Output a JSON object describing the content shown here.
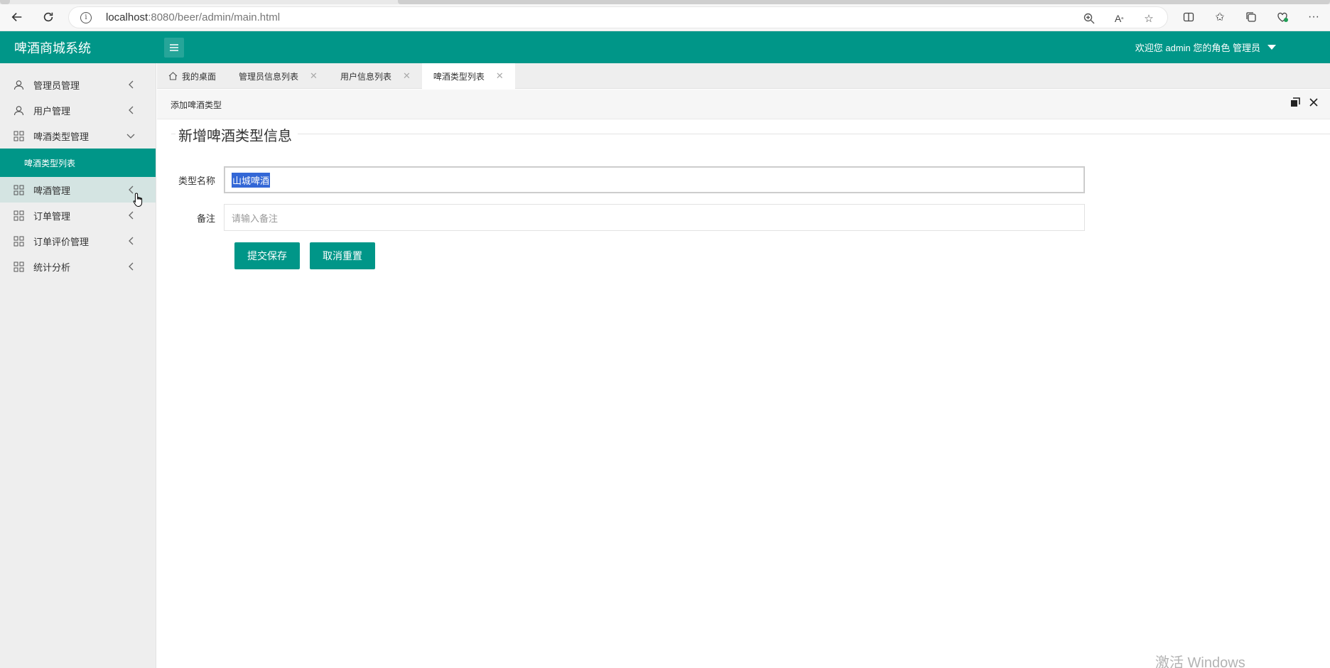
{
  "browser": {
    "url_host": "localhost",
    "url_rest": ":8080/beer/admin/main.html"
  },
  "app": {
    "title": "啤酒商城系统",
    "user_text": "欢迎您 admin 您的角色 管理员",
    "brand_color": "#009688"
  },
  "sidebar": {
    "items": [
      {
        "label": "管理员管理",
        "icon": "user-icon"
      },
      {
        "label": "用户管理",
        "icon": "user-icon"
      },
      {
        "label": "啤酒类型管理",
        "icon": "grid-icon",
        "expanded": true
      },
      {
        "label": "啤酒管理",
        "icon": "grid-icon"
      },
      {
        "label": "订单管理",
        "icon": "grid-icon"
      },
      {
        "label": "订单评价管理",
        "icon": "grid-icon"
      },
      {
        "label": "统计分析",
        "icon": "grid-icon"
      }
    ],
    "sub_item": "啤酒类型列表"
  },
  "tabs": [
    {
      "label": "我的桌面"
    },
    {
      "label": "管理员信息列表"
    },
    {
      "label": "用户信息列表"
    },
    {
      "label": "啤酒类型列表"
    }
  ],
  "subheader": {
    "title": "添加啤酒类型"
  },
  "form": {
    "legend": "新增啤酒类型信息",
    "name_label": "类型名称",
    "name_value": "山城啤酒",
    "remark_label": "备注",
    "remark_placeholder": "请输入备注",
    "submit_label": "提交保存",
    "reset_label": "取消重置"
  },
  "watermark": "激活 Windows"
}
